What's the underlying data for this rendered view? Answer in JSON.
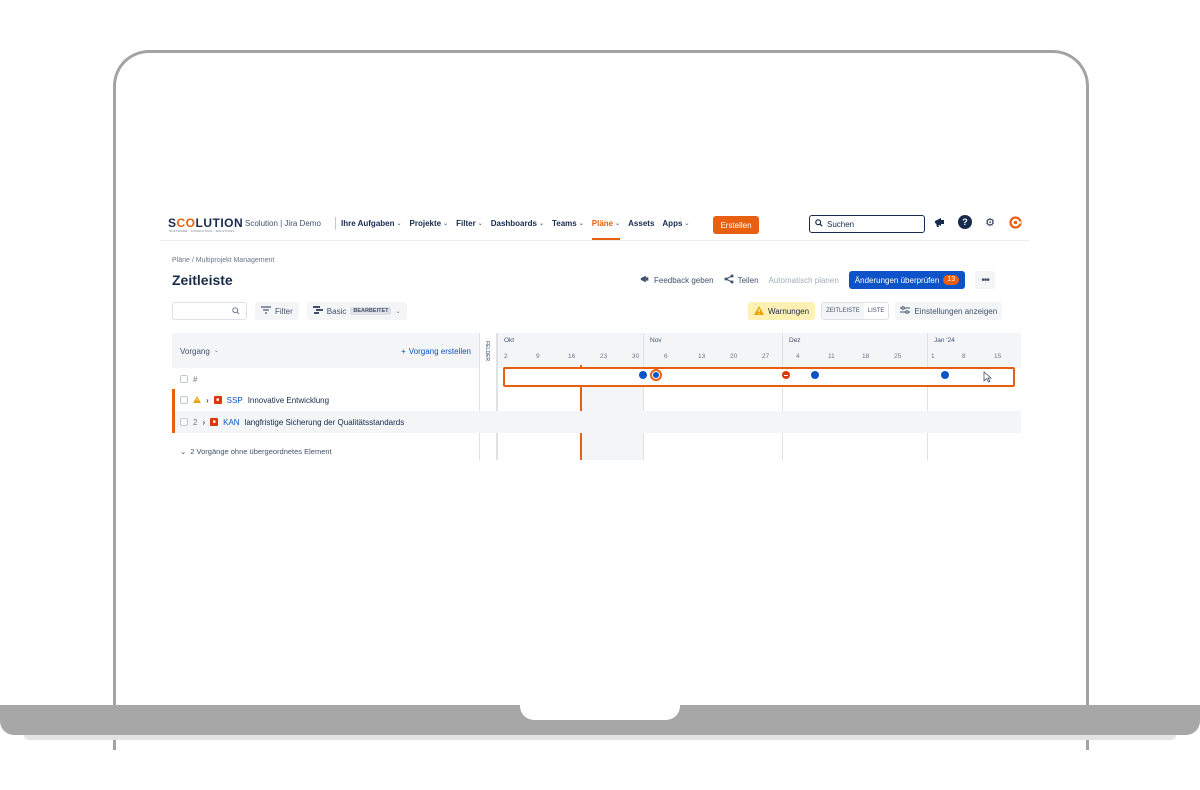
{
  "brand": {
    "logo_pre": "S",
    "logo_mid": "CO",
    "logo_post": "LUTION",
    "logo_sub": "SOFTWARE · CONSULTING · SOLUTIONS",
    "accent": "#e8600f",
    "primary": "#0c53c7"
  },
  "topnav": {
    "site_title": "Scolution | Jira Demo",
    "items": [
      {
        "label": "Ihre Aufgaben",
        "dropdown": true
      },
      {
        "label": "Projekte",
        "dropdown": true
      },
      {
        "label": "Filter",
        "dropdown": true
      },
      {
        "label": "Dashboards",
        "dropdown": true
      },
      {
        "label": "Teams",
        "dropdown": true
      },
      {
        "label": "Pläne",
        "dropdown": true,
        "active": true
      },
      {
        "label": "Assets",
        "dropdown": false
      },
      {
        "label": "Apps",
        "dropdown": true
      }
    ],
    "create_label": "Erstellen",
    "search_placeholder": "Suchen",
    "icons": [
      "megaphone-icon",
      "help-icon",
      "settings-icon",
      "profile-icon"
    ]
  },
  "page": {
    "breadcrumb": "Pläne  /  Multiprojekt Management",
    "title": "Zeitleiste",
    "feedback_label": "Feedback geben",
    "share_label": "Teilen",
    "auto_plan_label": "Automatisch planen",
    "review_label": "Änderungen überprüfen",
    "review_count": "13"
  },
  "toolbar": {
    "filter_label": "Filter",
    "basic_label": "Basic",
    "edited_badge": "BEARBEITET",
    "warnings_label": "Warnungen",
    "view_timeline": "ZEITLEISTE",
    "view_list": "LISTE",
    "settings_label": "Einstellungen anzeigen"
  },
  "timeline": {
    "issue_col_label": "Vorgang",
    "create_issue_label": "Vorgang erstellen",
    "fields_label": "FELDER",
    "months": [
      {
        "label": "Okt",
        "weeks": [
          "2",
          "9",
          "16",
          "23",
          "30"
        ]
      },
      {
        "label": "Nov",
        "weeks": [
          "6",
          "13",
          "20",
          "27"
        ]
      },
      {
        "label": "Dez",
        "weeks": [
          "4",
          "11",
          "18",
          "25"
        ]
      },
      {
        "label": "Jan '24",
        "weeks": [
          "1",
          "8",
          "15"
        ]
      }
    ],
    "release_row_hash": "#",
    "rows": [
      {
        "num": "",
        "warning": true,
        "project_key": "SSP",
        "title": "Innovative Entwicklung"
      },
      {
        "num": "2",
        "warning": false,
        "project_key": "KAN",
        "title": "langfristige Sicherung der Qualitätsstandards"
      }
    ],
    "group_label": "2 Vorgänge ohne übergeordnetes Element"
  }
}
